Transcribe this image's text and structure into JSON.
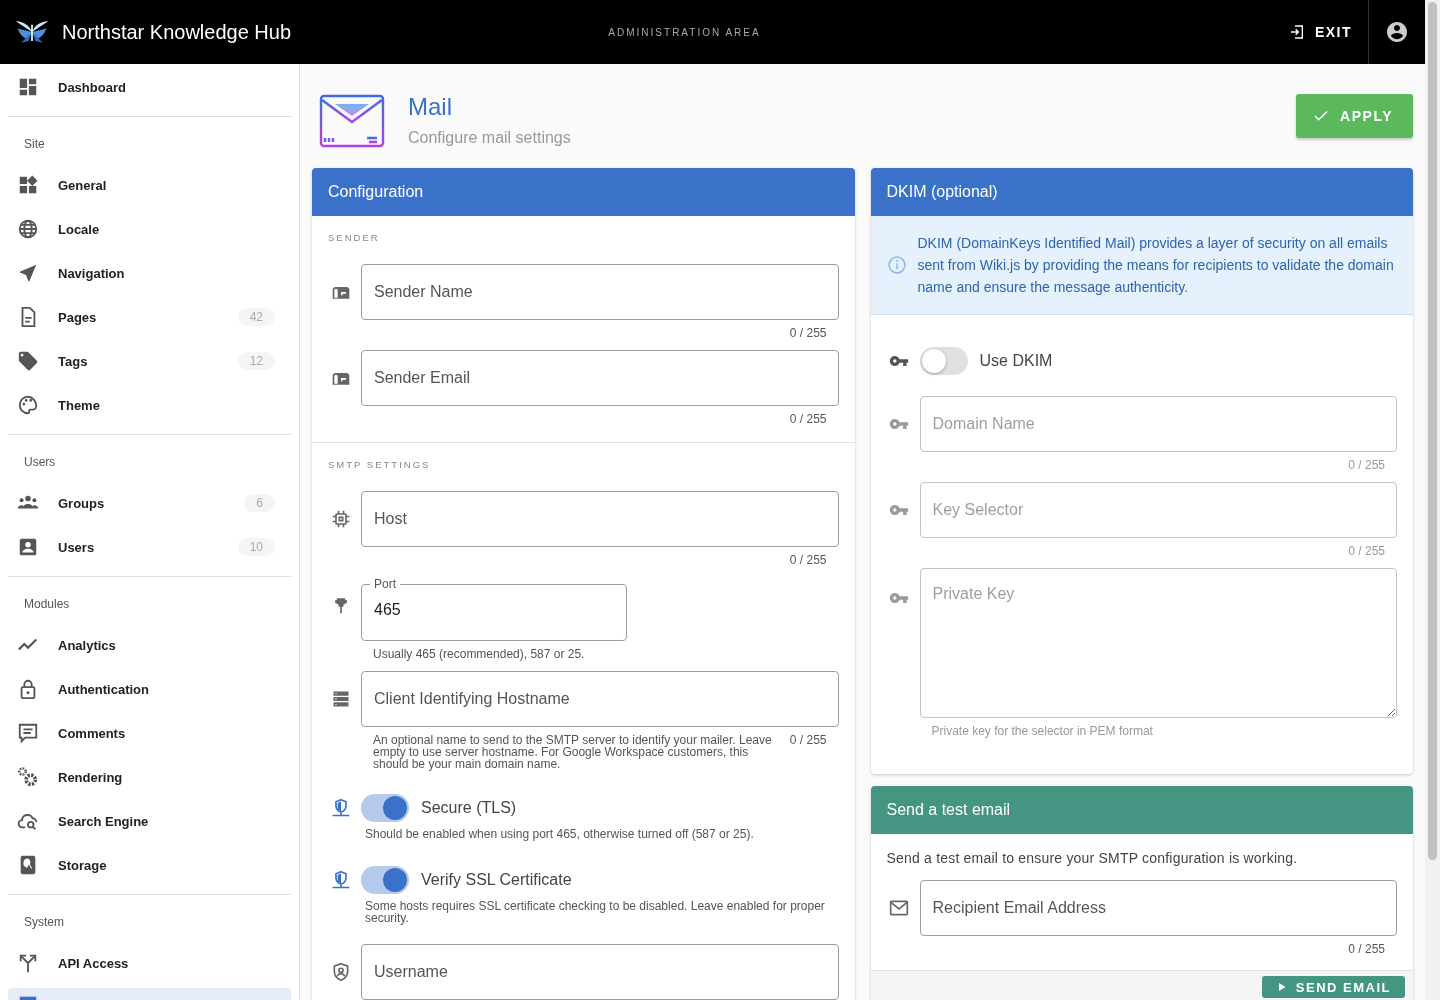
{
  "header": {
    "title": "Northstar Knowledge Hub",
    "area_label": "ADMINISTRATION AREA",
    "exit_label": "EXIT"
  },
  "sidebar": {
    "sections": [
      {
        "items": [
          {
            "label": "Dashboard",
            "selected": false
          }
        ]
      },
      {
        "heading": "Site",
        "items": [
          {
            "label": "General",
            "selected": false
          },
          {
            "label": "Locale",
            "selected": false
          },
          {
            "label": "Navigation",
            "selected": false
          },
          {
            "label": "Pages",
            "count": "42",
            "selected": false
          },
          {
            "label": "Tags",
            "count": "12",
            "selected": false
          },
          {
            "label": "Theme",
            "selected": false
          }
        ]
      },
      {
        "heading": "Users",
        "items": [
          {
            "label": "Groups",
            "count": "6",
            "selected": false
          },
          {
            "label": "Users",
            "count": "10",
            "selected": false
          }
        ]
      },
      {
        "heading": "Modules",
        "items": [
          {
            "label": "Analytics",
            "selected": false
          },
          {
            "label": "Authentication",
            "selected": false
          },
          {
            "label": "Comments",
            "selected": false
          },
          {
            "label": "Rendering",
            "selected": false
          },
          {
            "label": "Search Engine",
            "selected": false
          },
          {
            "label": "Storage",
            "selected": false
          }
        ]
      },
      {
        "heading": "System",
        "items": [
          {
            "label": "API Access",
            "selected": false
          },
          {
            "selected": true
          }
        ]
      }
    ]
  },
  "page": {
    "title": "Mail",
    "subtitle": "Configure mail settings",
    "apply_label": "APPLY"
  },
  "configuration": {
    "title": "Configuration",
    "groups": [
      {
        "heading": "SENDER",
        "fields": [
          {
            "kind": "text",
            "placeholder": "Sender Name",
            "counter": "0 / 255"
          },
          {
            "kind": "text",
            "placeholder": "Sender Email",
            "counter": "0 / 255"
          }
        ]
      },
      {
        "heading": "SMTP SETTINGS",
        "fields": [
          {
            "kind": "text",
            "placeholder": "Host",
            "counter": "0 / 255"
          },
          {
            "kind": "labeled",
            "label": "Port",
            "value": "465",
            "hint": "Usually 465 (recommended), 587 or 25."
          },
          {
            "kind": "text",
            "placeholder": "Client Identifying Hostname",
            "counter": "0 / 255",
            "hint": "An optional name to send to the SMTP server to identify your mailer. Leave empty to use server hostname. For Google Workspace customers, this should be your main domain name."
          },
          {
            "kind": "switch",
            "label": "Secure (TLS)",
            "on": true,
            "hint": "Should be enabled when using port 465, otherwise turned off (587 or 25)."
          },
          {
            "kind": "switch",
            "label": "Verify SSL Certificate",
            "on": true,
            "hint": "Some hosts requires SSL certificate checking to be disabled. Leave enabled for proper security."
          },
          {
            "kind": "text",
            "placeholder": "Username"
          }
        ]
      }
    ]
  },
  "dkim": {
    "title": "DKIM (optional)",
    "info": "DKIM (DomainKeys Identified Mail) provides a layer of security on all emails sent from Wiki.js by providing the means for recipients to validate the domain name and ensure the message authenticity.",
    "fields": [
      {
        "kind": "switch",
        "label": "Use DKIM",
        "on": false,
        "disabled": false
      },
      {
        "kind": "text",
        "placeholder": "Domain Name",
        "counter": "0 / 255",
        "disabled": true
      },
      {
        "kind": "text",
        "placeholder": "Key Selector",
        "counter": "0 / 255",
        "disabled": true
      },
      {
        "kind": "textarea",
        "placeholder": "Private Key",
        "hint": "Private key for the selector in PEM format",
        "disabled": true
      }
    ]
  },
  "test_email": {
    "title": "Send a test email",
    "text": "Send a test email to ensure your SMTP configuration is working.",
    "fields": [
      {
        "kind": "text",
        "placeholder": "Recipient Email Address",
        "counter": "0 / 255"
      }
    ],
    "button_label": "SEND EMAIL"
  }
}
